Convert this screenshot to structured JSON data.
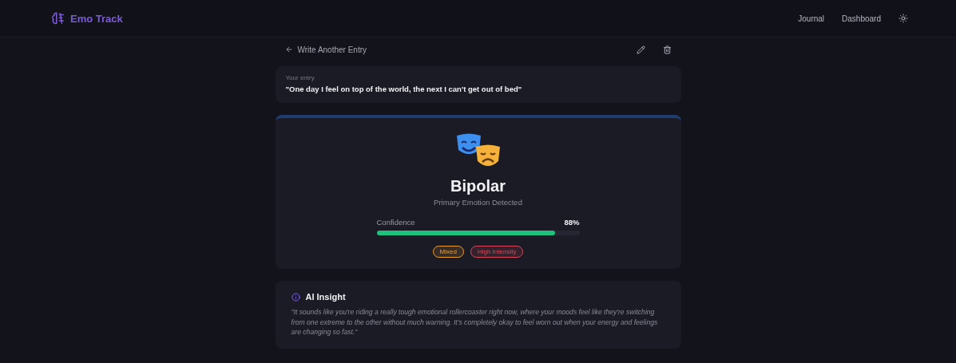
{
  "header": {
    "brand": "Emo Track",
    "nav": [
      {
        "label": "Journal"
      },
      {
        "label": "Dashboard"
      }
    ]
  },
  "toolbar": {
    "back_label": "Write Another Entry"
  },
  "entry": {
    "label": "Your entry",
    "text": "\"One day I feel on top of the world, the next I can't get out of bed\""
  },
  "result": {
    "emotion": "Bipolar",
    "subtitle": "Primary Emotion Detected",
    "confidence_label": "Confidence",
    "confidence_value": "88%",
    "level": 0.88,
    "tags": [
      {
        "label": "Mixed",
        "color": "#f0a030"
      },
      {
        "label": "High Intensity",
        "color": "#e0485a"
      }
    ]
  },
  "insight": {
    "title": "AI Insight",
    "text": "\"It sounds like you're riding a really tough emotional rollercoaster right now, where your moods feel like they're switching from one extreme to the other without much warning. It's completely okay to feel worn out when your energy and feelings are changing so fast.\""
  }
}
